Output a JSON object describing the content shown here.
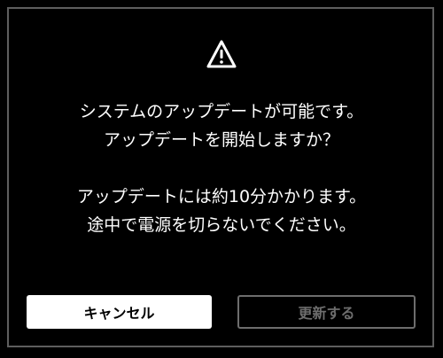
{
  "dialog": {
    "icon": "warning-triangle-icon",
    "message_lines": [
      "システムのアップデートが可能です。",
      "アップデートを開始しますか？"
    ],
    "detail_lines": [
      "アップデートには約10分かかります。",
      "途中で電源を切らないでください。"
    ],
    "cancel_label": "キャンセル",
    "update_label": "更新する"
  },
  "colors": {
    "background": "#000000",
    "border": "#5e5e5e",
    "text": "#ffffff",
    "disabled": "#6d6d6d"
  }
}
